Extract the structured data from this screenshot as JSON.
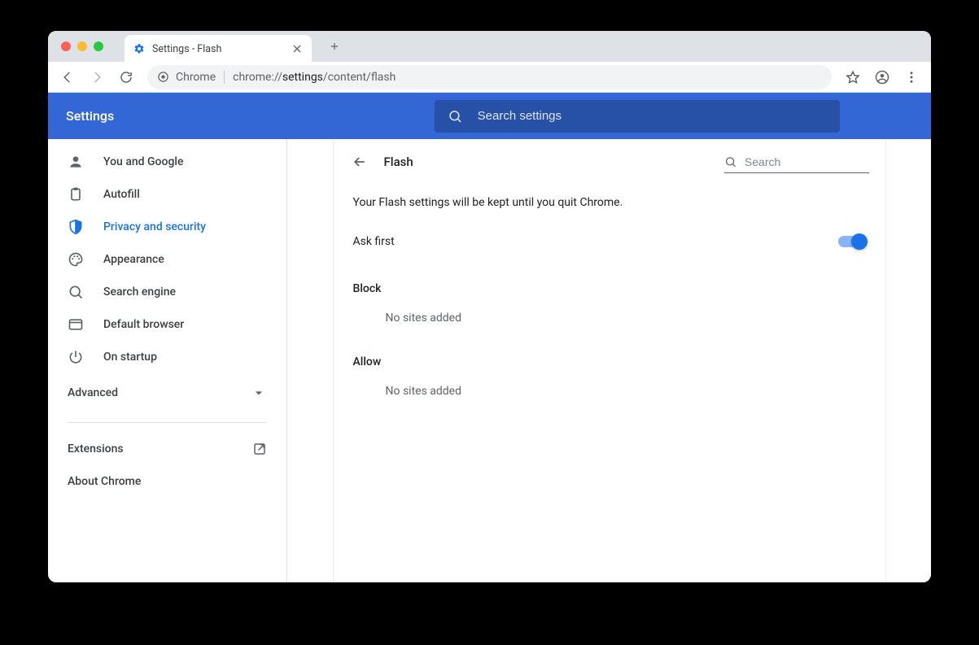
{
  "browser_tab": {
    "title": "Settings - Flash"
  },
  "omnibox": {
    "scheme_label": "Chrome",
    "url_light1": "chrome://",
    "url_dark": "settings",
    "url_light2": "/content/flash"
  },
  "app": {
    "title": "Settings",
    "search_placeholder": "Search settings"
  },
  "sidebar": {
    "items": [
      {
        "label": "You and Google"
      },
      {
        "label": "Autofill"
      },
      {
        "label": "Privacy and security"
      },
      {
        "label": "Appearance"
      },
      {
        "label": "Search engine"
      },
      {
        "label": "Default browser"
      },
      {
        "label": "On startup"
      }
    ],
    "advanced": "Advanced",
    "extensions": "Extensions",
    "about": "About Chrome"
  },
  "panel": {
    "title": "Flash",
    "search_placeholder": "Search",
    "notice": "Your Flash settings will be kept until you quit Chrome.",
    "toggle_label": "Ask first",
    "toggle_on": true,
    "block_heading": "Block",
    "block_empty": "No sites added",
    "allow_heading": "Allow",
    "allow_empty": "No sites added"
  }
}
